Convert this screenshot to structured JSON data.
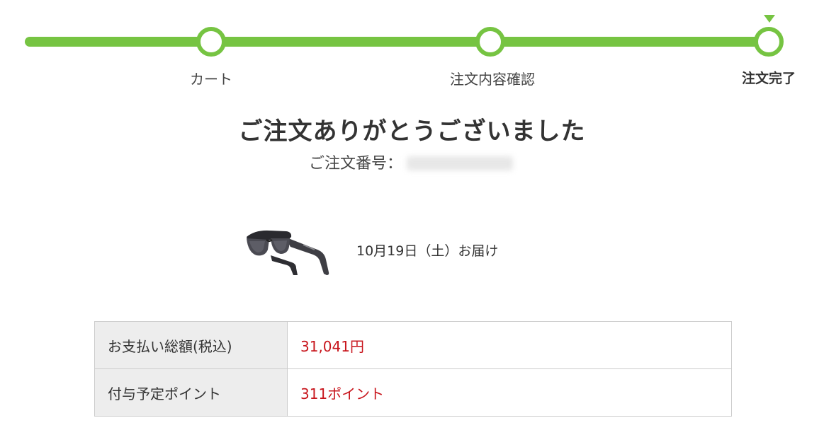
{
  "steps": [
    {
      "label": "カート",
      "active": false
    },
    {
      "label": "注文内容確認",
      "active": false
    },
    {
      "label": "注文完了",
      "active": true
    }
  ],
  "title": "ご注文ありがとうございました",
  "order_number": {
    "label": "ご注文番号："
  },
  "product": {
    "image_icon": "xr-glasses-image",
    "delivery": "10月19日（土）お届け"
  },
  "summary": {
    "rows": [
      {
        "label": "お支払い総額(税込)",
        "value": "31,041円"
      },
      {
        "label": "付与予定ポイント",
        "value": "311ポイント"
      }
    ]
  },
  "colors": {
    "accent": "#76c442",
    "price": "#c8161d"
  }
}
